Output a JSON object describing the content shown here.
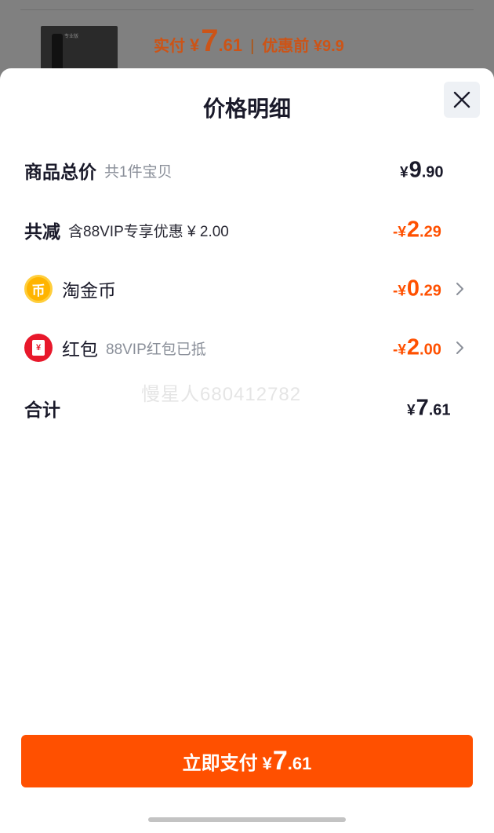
{
  "background_order": {
    "thumb_label": "专业版",
    "paid_label": "实付",
    "paid_yen": "¥",
    "paid_int": "7",
    "paid_dec": ".61",
    "separator": "|",
    "original_label": "优惠前 ¥9.9"
  },
  "sheet": {
    "title": "价格明细",
    "close_icon": "close-icon"
  },
  "rows": {
    "subtotal": {
      "label": "商品总价",
      "sub": "共1件宝贝",
      "yen": "¥",
      "int": "9",
      "dec": ".90"
    },
    "discount": {
      "label": "共减",
      "sub": "含88VIP专享优惠 ¥ 2.00",
      "prefix": "-¥",
      "int": "2",
      "dec": ".29"
    },
    "coins": {
      "icon": "taojinbi-coin-icon",
      "icon_glyph": "币",
      "label": "淘金币",
      "prefix": "-¥",
      "int": "0",
      "dec": ".29"
    },
    "redpacket": {
      "icon": "red-envelope-icon",
      "icon_glyph": "¥",
      "label": "红包",
      "sub": "88VIP红包已抵",
      "prefix": "-¥",
      "int": "2",
      "dec": ".00"
    },
    "total": {
      "label": "合计",
      "yen": "¥",
      "int": "7",
      "dec": ".61"
    }
  },
  "watermark": "慢星人680412782",
  "pay_button": {
    "label": "立即支付",
    "yen": "¥",
    "int": "7",
    "dec": ".61"
  },
  "colors": {
    "accent": "#ff5000",
    "text": "#1a1a2a",
    "muted": "#8a8f99"
  }
}
